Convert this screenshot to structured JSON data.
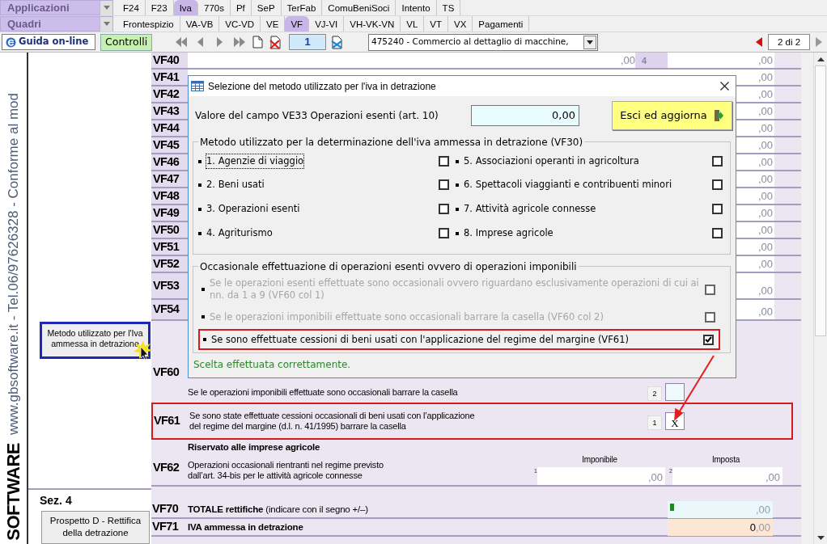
{
  "apps_menu": {
    "label": "Applicazioni"
  },
  "app_tabs": [
    {
      "label": "F24",
      "selected": false
    },
    {
      "label": "F23",
      "selected": false
    },
    {
      "label": "Iva",
      "selected": true
    },
    {
      "label": "770s",
      "selected": false
    },
    {
      "label": "Pf",
      "selected": false
    },
    {
      "label": "SeP",
      "selected": false
    },
    {
      "label": "TerFab",
      "selected": false
    },
    {
      "label": "ComuBeniSoci",
      "selected": false
    },
    {
      "label": "Intento",
      "selected": false
    },
    {
      "label": "TS",
      "selected": false
    }
  ],
  "quadri_menu": {
    "label": "Quadri"
  },
  "quadri_tabs": [
    {
      "label": "Frontespizio",
      "selected": false
    },
    {
      "label": "VA-VB",
      "selected": false
    },
    {
      "label": "VC-VD",
      "selected": false
    },
    {
      "label": "VE",
      "selected": false
    },
    {
      "label": "VF",
      "selected": true
    },
    {
      "label": "VJ-VI",
      "selected": false
    },
    {
      "label": "VH-VK-VN",
      "selected": false
    },
    {
      "label": "VL",
      "selected": false
    },
    {
      "label": "VT",
      "selected": false
    },
    {
      "label": "VX",
      "selected": false
    },
    {
      "label": "Pagamenti",
      "selected": false
    }
  ],
  "toolbar": {
    "help_button": "Guida on-line",
    "check_button": "Controlli",
    "page_number": "1",
    "activity": "475240 - Commercio al dettaglio di macchine,",
    "page_count": "2 di 2"
  },
  "sidebar": {
    "contact": "www.gbsoftware.it - Tel.06/97626328 - Conforme al mod",
    "brand": "SOFTWARE"
  },
  "left_panel": {
    "method_button": "Metodo utilizzato per l'Iva ammessa in detrazione",
    "section_label": "Sez. 4",
    "prospetto_button": "Prospetto D - Rettifica della detrazione"
  },
  "rows": [
    {
      "code": "VF40",
      "kind": "single",
      "mid_value": ",00",
      "mid_code": "4",
      "value": ",00"
    },
    {
      "code": "VF41",
      "kind": "single",
      "value": ",00"
    },
    {
      "code": "VF42",
      "kind": "single",
      "value": ",00"
    },
    {
      "code": "VF43",
      "kind": "single",
      "value": ",00"
    },
    {
      "code": "VF44",
      "kind": "single",
      "value": ",00"
    },
    {
      "code": "VF45",
      "kind": "single",
      "value": ",00"
    },
    {
      "code": "VF46",
      "kind": "single",
      "value": ",00"
    },
    {
      "code": "VF47",
      "kind": "single",
      "value": ",00"
    },
    {
      "code": "VF48",
      "kind": "single",
      "value": ",00"
    },
    {
      "code": "VF49",
      "kind": "single",
      "value": ",00"
    },
    {
      "code": "VF50",
      "kind": "single",
      "value": ",00"
    },
    {
      "code": "VF51",
      "kind": "single",
      "value": ",00"
    },
    {
      "code": "VF52",
      "kind": "single",
      "value": ",00"
    },
    {
      "code": "VF53",
      "kind": "double",
      "value": ",00"
    },
    {
      "code": "VF54",
      "kind": "medium",
      "value": ",00"
    }
  ],
  "vf60": {
    "code": "VF60",
    "text": "Se le operazioni imponibili effettuate sono occasionali barrare la casella",
    "box_code": "2",
    "checked": false
  },
  "vf61": {
    "code": "VF61",
    "text_lines": [
      "Se sono state effettuate cessioni occasionali di beni usati con l’applicazione",
      "del regime del margine (d.l. n. 41/1995) barrare la casella"
    ],
    "box_code": "1",
    "box_value": "X",
    "highlighted": true
  },
  "vf62": {
    "heading": "Riservato alle imprese agricole",
    "code": "VF62",
    "text_lines": [
      "Operazioni occasionali rientranti nel regime previsto",
      "dall’art. 34-bis per le attività agricole connesse"
    ],
    "columns": [
      {
        "label": "Imponibile",
        "code": "1",
        "value": ",00"
      },
      {
        "label": "Imposta",
        "code": "2",
        "value": ",00"
      }
    ]
  },
  "totals": [
    {
      "code": "VF70",
      "kind": "computed",
      "text": "**TOTALE rettifiche** (indicare con il segno +/–)",
      "suffix": ",00"
    },
    {
      "code": "VF71",
      "kind": "result",
      "text": "IVA ammessa in detrazione",
      "value": "0",
      "suffix": ",00"
    }
  ],
  "dialog": {
    "title": "Selezione del metodo utilizzato per l'iva in detrazione",
    "ve33_label": "Valore del campo VE33 Operazioni esenti (art. 10)",
    "ve33_value": "0,00",
    "exit_button": "Esci ed aggiorna",
    "method_group": {
      "legend": "Metodo utilizzato per la determinazione dell'iva ammessa in detrazione (VF30)",
      "options": [
        {
          "label": "1. Agenzie di viaggio",
          "checked": false,
          "focused": true
        },
        {
          "label": "2. Beni usati",
          "checked": false,
          "focused": false
        },
        {
          "label": "3. Operazioni esenti",
          "checked": false,
          "focused": false
        },
        {
          "label": "4. Agriturismo",
          "checked": false,
          "focused": false
        },
        {
          "label": "5. Associazioni operanti in agricoltura",
          "checked": false,
          "focused": false
        },
        {
          "label": "6. Spettacoli viaggianti e contribuenti minori",
          "checked": false,
          "focused": false
        },
        {
          "label": "7. Attività agricole connesse",
          "checked": false,
          "focused": false
        },
        {
          "label": "8. Imprese agricole",
          "checked": false,
          "focused": false
        }
      ]
    },
    "occasional_group": {
      "legend": "Occasionale effettuazione di operazioni esenti ovvero di operazioni imponibili",
      "options": [
        {
          "label": "Se le operazioni esenti effettuate sono occasionali ovvero riguardano esclusivamente operazioni di cui ai nn. da 1 a 9 (VF60 col 1)",
          "checked": false,
          "disabled": true,
          "highlighted": false
        },
        {
          "label": "Se le operazioni imponibili effettuate sono occasionali barrare la casella (VF60 col 2)",
          "checked": false,
          "disabled": true,
          "highlighted": false
        },
        {
          "label": "Se sono effettuate cessioni di beni usati con l'applicazione del regime del margine (VF61)",
          "checked": true,
          "disabled": false,
          "highlighted": true
        }
      ]
    },
    "status": "Scelta effettuata correttamente."
  }
}
